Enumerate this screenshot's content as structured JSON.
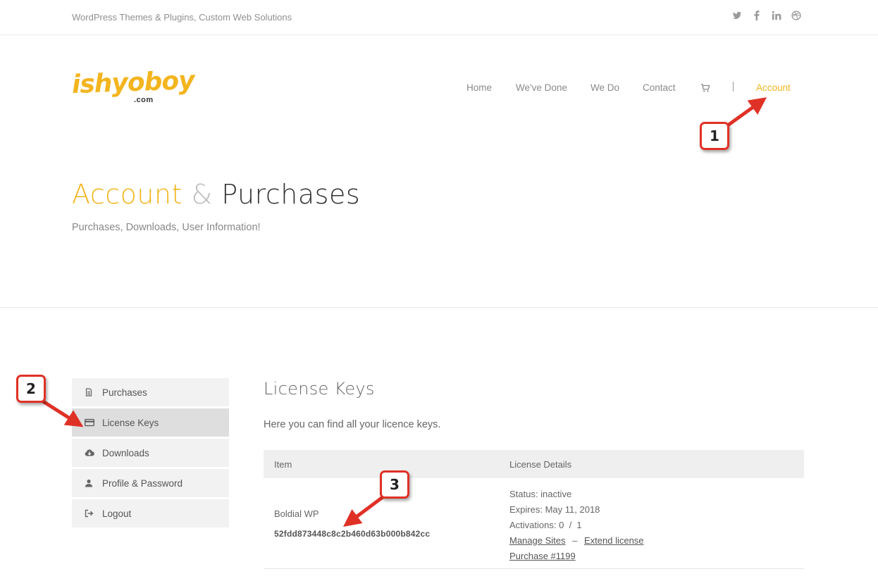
{
  "topbar": {
    "tagline": "WordPress Themes & Plugins, Custom Web Solutions",
    "social_icons": [
      "twitter-icon",
      "facebook-icon",
      "linkedin-icon",
      "dribbble-icon"
    ]
  },
  "logo": {
    "word": "ishyoboy",
    "suffix": ".com"
  },
  "nav": {
    "items": [
      "Home",
      "We've Done",
      "We Do",
      "Contact"
    ],
    "account_label": "Account",
    "cart_icon": "cart-icon"
  },
  "hero": {
    "title_accent": "Account",
    "title_amp": "&",
    "title_rest": "Purchases",
    "subtitle": "Purchases, Downloads, User Information!"
  },
  "sidebar": {
    "items": [
      {
        "label": "Purchases",
        "icon": "document-icon",
        "active": false
      },
      {
        "label": "License Keys",
        "icon": "credit-card-icon",
        "active": true
      },
      {
        "label": "Downloads",
        "icon": "cloud-download-icon",
        "active": false
      },
      {
        "label": "Profile & Password",
        "icon": "user-icon",
        "active": false
      },
      {
        "label": "Logout",
        "icon": "logout-icon",
        "active": false
      }
    ]
  },
  "main": {
    "title": "License Keys",
    "description": "Here you can find all your licence keys.",
    "table": {
      "headers": [
        "Item",
        "License Details"
      ],
      "rows": [
        {
          "item_name": "Boldial WP",
          "license_key": "52fdd873448c8c2b460d63b000b842cc",
          "status_label": "Status:",
          "status_value": "inactive",
          "expires_label": "Expires:",
          "expires_value": "May 11, 2018",
          "activations_label": "Activations:",
          "activations_value": "0  /  1",
          "manage_link": "Manage Sites",
          "dash": "–",
          "extend_link": "Extend license",
          "purchase_link": "Purchase #1199"
        }
      ]
    }
  },
  "annotations": {
    "callout_1": "1",
    "callout_2": "2",
    "callout_3": "3"
  },
  "colors": {
    "accent": "#f3b51e",
    "annotation": "#e03126"
  }
}
